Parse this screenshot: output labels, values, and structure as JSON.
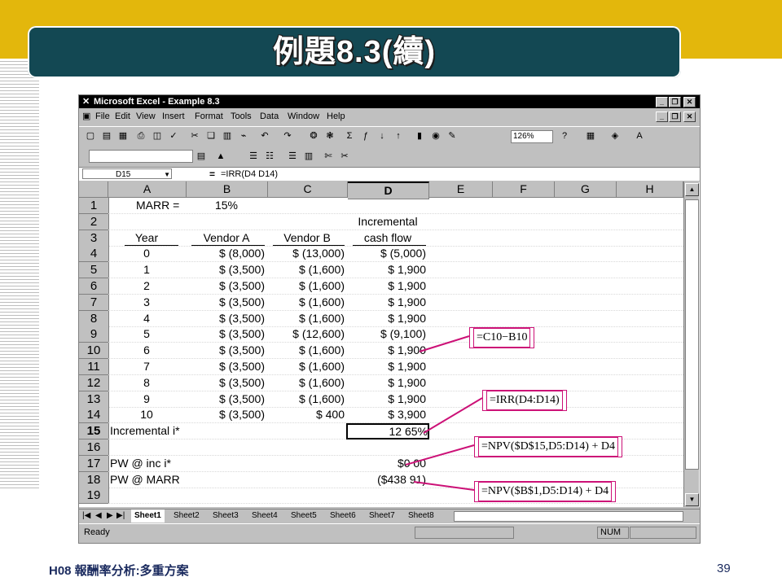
{
  "slide": {
    "title": "例題8.3(續)",
    "footer_left": "H08 報酬率分析:多重方案",
    "page_number": "39",
    "colors": {
      "top_bar": "#e3b70c",
      "title_box": "#134853",
      "callout": "#cc1177"
    }
  },
  "excel": {
    "window_title": "Microsoft Excel - Example 8.3",
    "menu": [
      "File",
      "Edit",
      "View",
      "Insert",
      "Format",
      "Tools",
      "Data",
      "Window",
      "Help"
    ],
    "zoom": "126%",
    "name_box": "D15",
    "formula": "=IRR(D4 D14)",
    "columns": [
      "A",
      "B",
      "C",
      "D",
      "E",
      "F",
      "G",
      "H"
    ],
    "rows": [
      {
        "n": "1",
        "a": "MARR =",
        "b": "15%",
        "c": "",
        "d": ""
      },
      {
        "n": "2",
        "a": "",
        "b": "",
        "c": "",
        "d": "Incremental"
      },
      {
        "n": "3",
        "a": "Year",
        "b": "Vendor A",
        "c": "Vendor B",
        "d": "cash flow"
      },
      {
        "n": "4",
        "a": "0",
        "b": "$    (8,000)",
        "c": "$   (13,000)",
        "d": "$    (5,000)"
      },
      {
        "n": "5",
        "a": "1",
        "b": "$    (3,500)",
        "c": "$     (1,600)",
        "d": "$      1,900"
      },
      {
        "n": "6",
        "a": "2",
        "b": "$    (3,500)",
        "c": "$     (1,600)",
        "d": "$      1,900"
      },
      {
        "n": "7",
        "a": "3",
        "b": "$    (3,500)",
        "c": "$     (1,600)",
        "d": "$      1,900"
      },
      {
        "n": "8",
        "a": "4",
        "b": "$    (3,500)",
        "c": "$     (1,600)",
        "d": "$      1,900"
      },
      {
        "n": "9",
        "a": "5",
        "b": "$    (3,500)",
        "c": "$   (12,600)",
        "d": "$     (9,100)"
      },
      {
        "n": "10",
        "a": "6",
        "b": "$    (3,500)",
        "c": "$     (1,600)",
        "d": "$      1,900"
      },
      {
        "n": "11",
        "a": "7",
        "b": "$    (3,500)",
        "c": "$     (1,600)",
        "d": "$      1,900"
      },
      {
        "n": "12",
        "a": "8",
        "b": "$    (3,500)",
        "c": "$     (1,600)",
        "d": "$      1,900"
      },
      {
        "n": "13",
        "a": "9",
        "b": "$    (3,500)",
        "c": "$     (1,600)",
        "d": "$      1,900"
      },
      {
        "n": "14",
        "a": "10",
        "b": "$    (3,500)",
        "c": "$           400",
        "d": "$      3,900"
      },
      {
        "n": "15",
        "a": "Incremental i*",
        "b": "",
        "c": "",
        "d": "12 65%"
      },
      {
        "n": "16",
        "a": "",
        "b": "",
        "c": "",
        "d": ""
      },
      {
        "n": "17",
        "a": "PW @ inc i*",
        "b": "",
        "c": "",
        "d": "$0 00"
      },
      {
        "n": "18",
        "a": "PW @ MARR",
        "b": "",
        "c": "",
        "d": "($438 91)"
      },
      {
        "n": "19",
        "a": "",
        "b": "",
        "c": "",
        "d": ""
      }
    ],
    "sheet_tabs": [
      "Sheet1",
      "Sheet2",
      "Sheet3",
      "Sheet4",
      "Sheet5",
      "Sheet6",
      "Sheet7",
      "Sheet8"
    ],
    "status_left": "Ready",
    "status_num": "NUM"
  },
  "callouts": {
    "c1": "=C10−B10",
    "c2": "=IRR(D4:D14)",
    "c3": "=NPV($D$15,D5:D14) + D4",
    "c4": "=NPV($B$1,D5:D14) + D4"
  }
}
